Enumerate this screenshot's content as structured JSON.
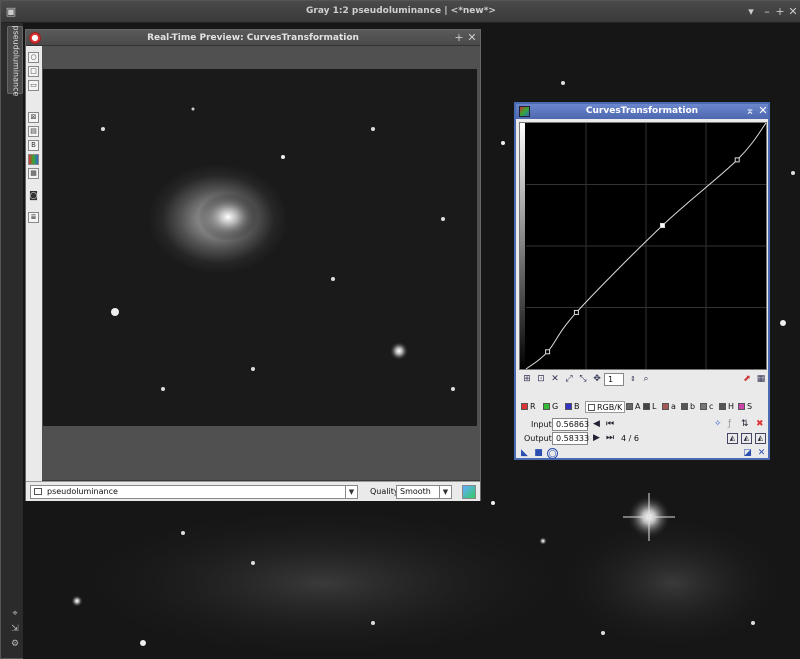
{
  "window": {
    "title": "Gray 1:2 pseudoluminance | <*new*>",
    "side_tab_label": "pseudoluminance"
  },
  "preview": {
    "title": "Real-Time Preview: CurvesTransformation",
    "view_select": "pseudoluminance",
    "quality_label": "Quality:",
    "quality_value": "Smooth"
  },
  "curves": {
    "title": "CurvesTransformation",
    "zoom_value": "1",
    "channels": [
      "R",
      "G",
      "B",
      "RGB/K",
      "A",
      "L",
      "a",
      "b",
      "c",
      "H",
      "S"
    ],
    "selected_channel": "RGB/K",
    "input_label": "Input:",
    "input_value": "0.56863",
    "output_label": "Output:",
    "output_value": "0.58333",
    "point_counter": "4 / 6",
    "curve_points": [
      [
        0,
        0
      ],
      [
        0.09,
        0.07
      ],
      [
        0.21,
        0.23
      ],
      [
        0.56863,
        0.58333
      ],
      [
        0.88,
        0.85
      ],
      [
        1,
        1
      ]
    ],
    "selected_point_index": 3
  },
  "colors": {
    "curves_accent": "#4a6ab4",
    "close_red": "#dd3333"
  }
}
